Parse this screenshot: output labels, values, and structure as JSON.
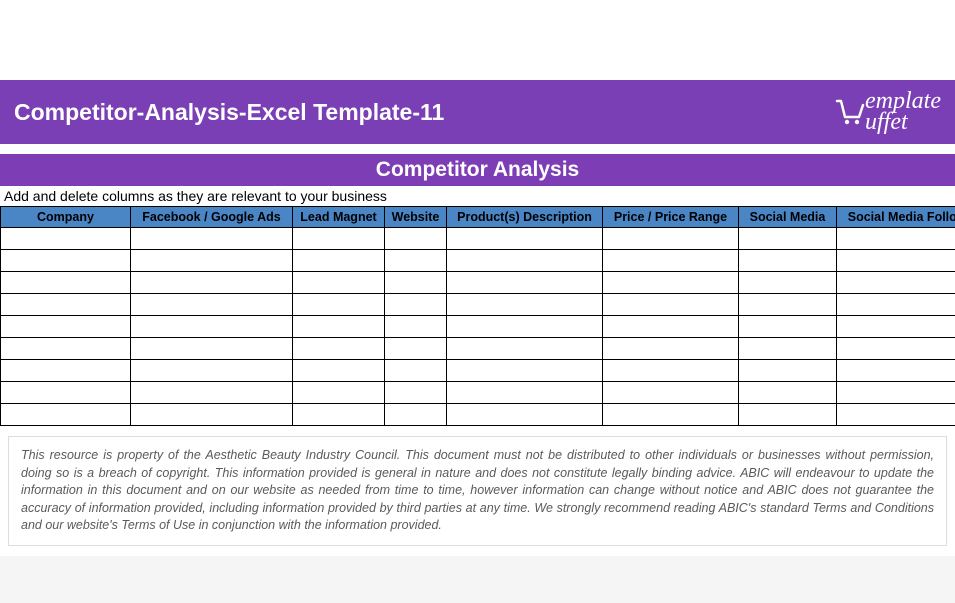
{
  "header": {
    "title": "Competitor-Analysis-Excel Template-11",
    "logo_text": "emplate",
    "logo_subtext": "uffet"
  },
  "section": {
    "title": "Competitor Analysis",
    "instructions": "Add and delete columns as they are relevant to your business"
  },
  "table": {
    "columns": [
      "Company",
      "Facebook / Google Ads",
      "Lead Magnet",
      "Website",
      "Product(s) Description",
      "Price / Price Range",
      "Social Media",
      "Social Media Following"
    ],
    "row_count": 9
  },
  "disclaimer": "This resource is property of the Aesthetic Beauty Industry Council. This document must not be distributed to other individuals or businesses without permission, doing so is a breach of copyright. This information provided is general in nature and does not constitute legally binding advice. ABIC will endeavour to update the information in this document and on our website as needed from time to time, however information can change without notice and ABIC does not guarantee the accuracy of information provided, including information provided by third parties at any time. We strongly recommend reading ABIC's standard Terms and Conditions and our website's Terms of Use in conjunction with the information provided."
}
